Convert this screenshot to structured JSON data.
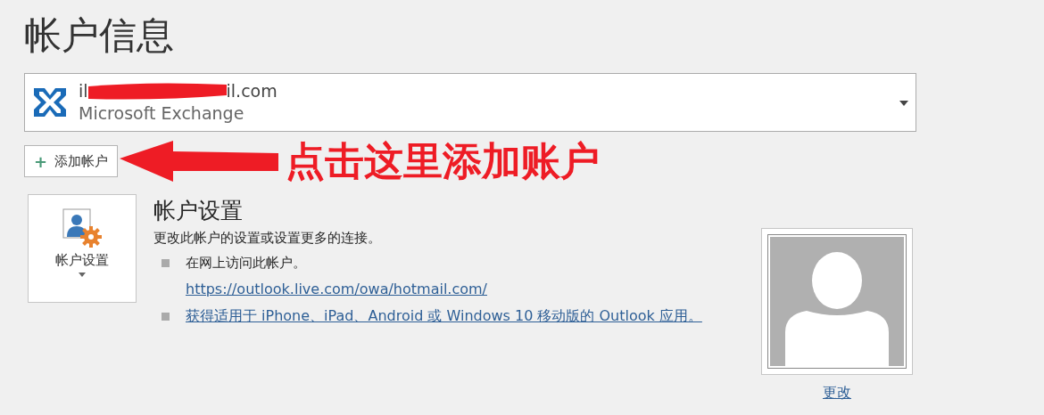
{
  "title": "帐户信息",
  "account": {
    "email_start": "il",
    "email_end": "il.com",
    "type": "Microsoft Exchange"
  },
  "add_account_button": {
    "icon": "+",
    "label": "添加帐户"
  },
  "annotation": {
    "text": "点击这里添加账户"
  },
  "settings_button": {
    "label": "帐户设置"
  },
  "settings": {
    "heading": "帐户设置",
    "description": "更改此帐户的设置或设置更多的连接。",
    "bullets": [
      {
        "kind": "text",
        "text": "在网上访问此帐户。",
        "link": "https://outlook.live.com/owa/hotmail.com/"
      },
      {
        "kind": "link",
        "text": "获得适用于 iPhone、iPad、Android 或 Windows 10 移动版的 Outlook 应用。"
      }
    ]
  },
  "photo": {
    "change_link": "更改"
  }
}
